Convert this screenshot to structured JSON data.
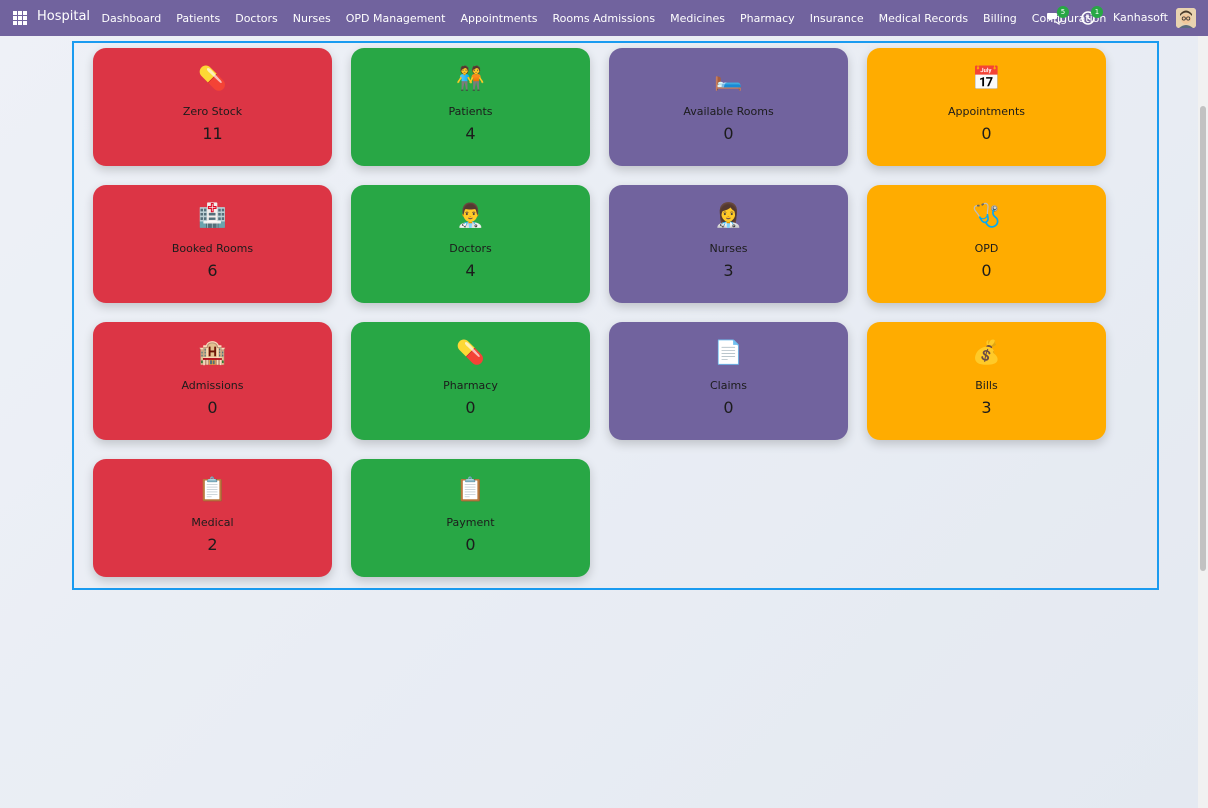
{
  "app": {
    "name": "Hospital",
    "user": "Kanhasoft",
    "chat_count": "5",
    "activity_count": "1"
  },
  "nav": [
    "Dashboard",
    "Patients",
    "Doctors",
    "Nurses",
    "OPD Management",
    "Appointments",
    "Rooms Admissions",
    "Medicines",
    "Pharmacy",
    "Insurance",
    "Medical Records",
    "Billing",
    "Configuration"
  ],
  "cards": [
    {
      "label": "Zero Stock",
      "value": "11",
      "icon": "💊",
      "icon_name": "pill-icon",
      "color": "#dc3545"
    },
    {
      "label": "Patients",
      "value": "4",
      "icon": "🧑‍🤝‍🧑",
      "icon_name": "patients-icon",
      "color": "#28a745"
    },
    {
      "label": "Available Rooms",
      "value": "0",
      "icon": "🛏️",
      "icon_name": "bed-icon",
      "color": "#71639e"
    },
    {
      "label": "Appointments",
      "value": "0",
      "icon": "📅",
      "icon_name": "calendar-icon",
      "color": "#ffac00"
    },
    {
      "label": "Booked Rooms",
      "value": "6",
      "icon": "🏥",
      "icon_name": "hospital-icon",
      "color": "#dc3545"
    },
    {
      "label": "Doctors",
      "value": "4",
      "icon": "👨‍⚕️",
      "icon_name": "doctor-icon",
      "color": "#28a745"
    },
    {
      "label": "Nurses",
      "value": "3",
      "icon": "👩‍⚕️",
      "icon_name": "nurse-icon",
      "color": "#71639e"
    },
    {
      "label": "OPD",
      "value": "0",
      "icon": "🩺",
      "icon_name": "stethoscope-icon",
      "color": "#ffac00"
    },
    {
      "label": "Admissions",
      "value": "0",
      "icon": "🏨",
      "icon_name": "hotel-icon",
      "color": "#dc3545"
    },
    {
      "label": "Pharmacy",
      "value": "0",
      "icon": "💊",
      "icon_name": "pill-icon",
      "color": "#28a745"
    },
    {
      "label": "Claims",
      "value": "0",
      "icon": "📄",
      "icon_name": "document-icon",
      "color": "#71639e"
    },
    {
      "label": "Bills",
      "value": "3",
      "icon": "💰",
      "icon_name": "money-bag-icon",
      "color": "#ffac00"
    },
    {
      "label": "Medical",
      "value": "2",
      "icon": "📋",
      "icon_name": "clipboard-icon",
      "color": "#dc3545"
    },
    {
      "label": "Payment",
      "value": "0",
      "icon": "📋",
      "icon_name": "clipboard-icon",
      "color": "#28a745"
    }
  ]
}
